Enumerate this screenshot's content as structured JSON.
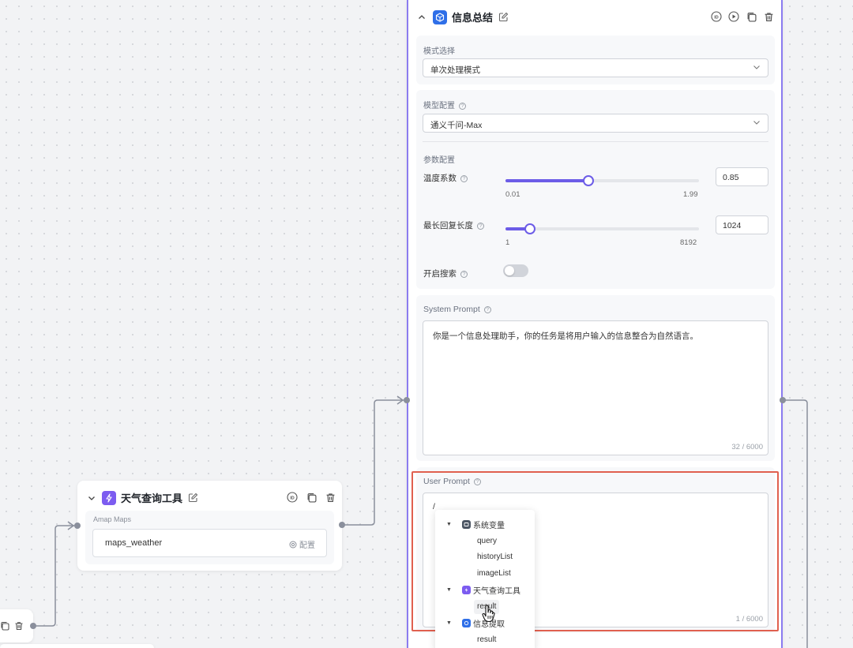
{
  "mini_card": {},
  "tool_node": {
    "title": "天气查询工具",
    "subtitle": "Amap Maps",
    "tool_name": "maps_weather",
    "config_label": "配置"
  },
  "main_node": {
    "title": "信息总结",
    "mode": {
      "label": "模式选择",
      "value": "单次处理模式"
    },
    "model": {
      "label": "模型配置",
      "value": "通义千问-Max"
    },
    "params": {
      "label": "参数配置",
      "temperature": {
        "label": "温度系数",
        "min": "0.01",
        "max": "1.99",
        "value": "0.85",
        "fraction": 0.43
      },
      "max_length": {
        "label": "最长回复长度",
        "min": "1",
        "max": "8192",
        "value": "1024",
        "fraction": 0.125
      },
      "search": {
        "label": "开启搜索",
        "enabled": false
      }
    },
    "system_prompt": {
      "label": "System Prompt",
      "text": "你是一个信息处理助手，你的任务是将用户输入的信息整合为自然语言。",
      "count": "32 / 6000"
    },
    "user_prompt": {
      "label": "User Prompt",
      "text": "/",
      "count": "1 / 6000"
    }
  },
  "variable_popup": {
    "groups": [
      {
        "label": "系统变量",
        "icon": "system-variable-icon",
        "color": "#4b5563",
        "items": [
          "query",
          "historyList",
          "imageList"
        ]
      },
      {
        "label": "天气查询工具",
        "icon": "tool-icon",
        "color": "#7c5cf0",
        "items": [
          "result"
        ]
      },
      {
        "label": "信息提取",
        "icon": "extract-icon",
        "color": "#2f6fe8",
        "items": [
          "result"
        ]
      }
    ]
  },
  "colors": {
    "accent": "#6c5ce7",
    "highlight": "#e0604f",
    "wire": "#8a8f9c"
  }
}
